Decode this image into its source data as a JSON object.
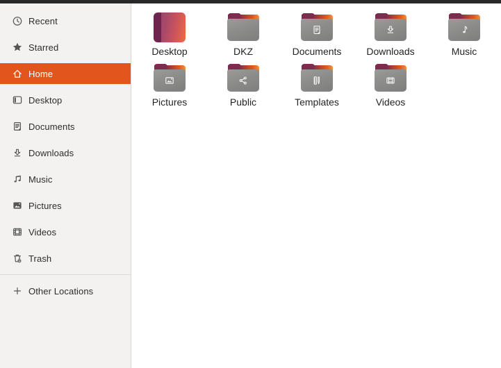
{
  "app": "files-file-manager",
  "colors": {
    "accent_selected": "#E2561E",
    "topbar": "#282828",
    "sidebar_bg": "#f3f2f1",
    "folder_body": "#8c8c8b",
    "folder_flap_left": "#7d2b4e",
    "folder_flap_right": "#df5a1d",
    "desktop_tile_gradient": [
      "#6d2550",
      "#904070",
      "#ec6f42"
    ]
  },
  "sidebar": {
    "items": [
      {
        "label": "Recent",
        "icon": "recent-clock-icon",
        "selected": false
      },
      {
        "label": "Starred",
        "icon": "star-icon",
        "selected": false
      },
      {
        "label": "Home",
        "icon": "home-icon",
        "selected": true
      },
      {
        "label": "Desktop",
        "icon": "desktop-icon",
        "selected": false
      },
      {
        "label": "Documents",
        "icon": "document-icon",
        "selected": false
      },
      {
        "label": "Downloads",
        "icon": "download-icon",
        "selected": false
      },
      {
        "label": "Music",
        "icon": "music-note-icon",
        "selected": false
      },
      {
        "label": "Pictures",
        "icon": "image-icon",
        "selected": false
      },
      {
        "label": "Videos",
        "icon": "film-icon",
        "selected": false
      },
      {
        "label": "Trash",
        "icon": "trash-icon",
        "selected": false
      }
    ],
    "other_locations": {
      "label": "Other Locations",
      "icon": "plus-icon"
    }
  },
  "files": {
    "items": [
      {
        "label": "Desktop",
        "icon": "ubuntu-gradient-tile"
      },
      {
        "label": "DKZ",
        "icon": "folder-plain"
      },
      {
        "label": "Documents",
        "icon": "folder-document-emblem"
      },
      {
        "label": "Downloads",
        "icon": "folder-download-emblem"
      },
      {
        "label": "Music",
        "icon": "folder-music-emblem"
      },
      {
        "label": "Pictures",
        "icon": "folder-image-emblem"
      },
      {
        "label": "Public",
        "icon": "folder-share-emblem"
      },
      {
        "label": "Templates",
        "icon": "folder-template-emblem"
      },
      {
        "label": "Videos",
        "icon": "folder-film-emblem"
      }
    ]
  }
}
